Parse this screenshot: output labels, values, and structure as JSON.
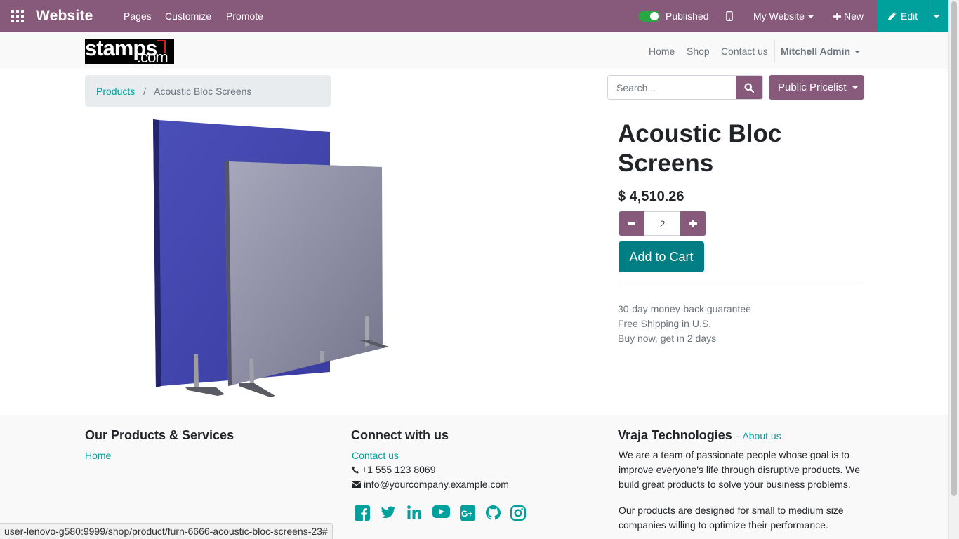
{
  "admin_bar": {
    "app_name": "Website",
    "menus": [
      "Pages",
      "Customize",
      "Promote"
    ],
    "published_label": "Published",
    "published": true,
    "website_selector": "My Website",
    "new_label": "New",
    "edit_label": "Edit",
    "color": "#875a7b",
    "edit_color": "#00a09d"
  },
  "site_header": {
    "logo_text": "stamps",
    "logo_subtext": ".com",
    "nav": [
      "Home",
      "Shop",
      "Contact us"
    ],
    "user": "Mitchell Admin"
  },
  "breadcrumb": {
    "items": [
      "Products",
      "Acoustic Bloc Screens"
    ],
    "separator": "/"
  },
  "search": {
    "placeholder": "Search..."
  },
  "pricelist_label": "Public Pricelist",
  "product": {
    "name": "Acoustic Bloc Screens",
    "price": "$ 4,510.26",
    "quantity": "2",
    "add_to_cart_label": "Add to Cart",
    "perks": [
      "30-day money-back guarantee",
      "Free Shipping in U.S.",
      "Buy now, get in 2 days"
    ],
    "accent_color": "#017e84"
  },
  "footer": {
    "col1": {
      "title": "Our Products & Services",
      "links": [
        "Home"
      ]
    },
    "col2": {
      "title": "Connect with us",
      "contact_link": "Contact us",
      "phone": "+1 555 123 8069",
      "email": "info@yourcompany.example.com",
      "social_icons": [
        "facebook-icon",
        "twitter-icon",
        "linkedin-icon",
        "youtube-icon",
        "google-plus-icon",
        "github-icon",
        "instagram-icon"
      ]
    },
    "col3": {
      "title": "Vraja Technologies",
      "title_link": "About us",
      "para1": "We are a team of passionate people whose goal is to improve everyone's life through disruptive products. We build great products to solve your business problems.",
      "para2": "Our products are designed for small to medium size companies willing to optimize their performance."
    }
  },
  "status_url": "user-lenovo-g580:9999/shop/product/furn-6666-acoustic-bloc-screens-23#"
}
